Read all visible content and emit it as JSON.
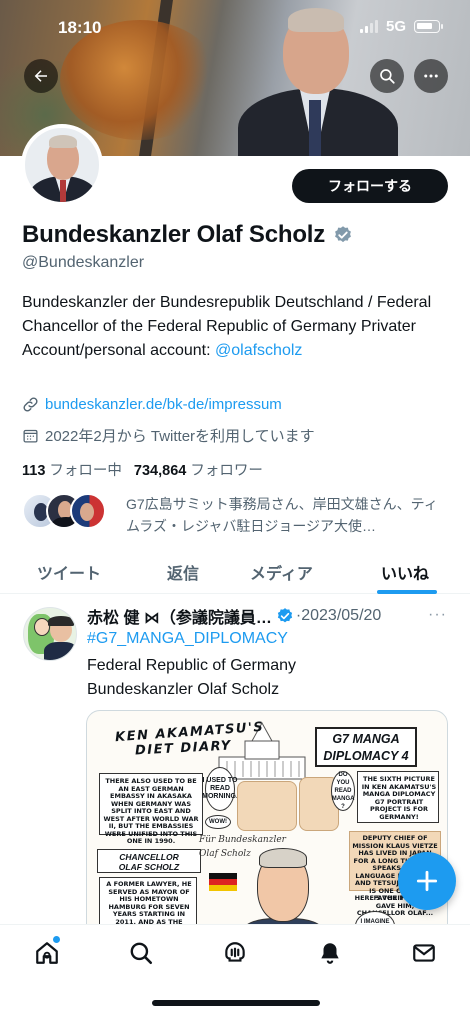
{
  "status_bar": {
    "time": "18:10",
    "network": "5G"
  },
  "header": {
    "back_icon": "arrow-left-icon",
    "search_icon": "search-icon",
    "more_icon": "more-horizontal-icon"
  },
  "profile": {
    "follow_label": "フォローする",
    "name": "Bundeskanzler Olaf Scholz",
    "handle": "@Bundeskanzler",
    "bio": "Bundeskanzler der Bundesrepublik Deutschland / Federal Chancellor of the Federal Republic of Germany Privater Account/personal account:",
    "bio_mention": "@olafscholz",
    "link": "bundeskanzler.de/bk-de/impressum",
    "joined": "2022年2月から Twitterを利用しています",
    "following_count": "113",
    "following_label": "フォロー中",
    "followers_count": "734,864",
    "followers_label": "フォロワー",
    "known_followers": "G7広島サミット事務局さん、岸田文雄さん、ティムラズ・レジャバ駐日ジョージア大使…"
  },
  "tabs": [
    {
      "label": "ツイート"
    },
    {
      "label": "返信"
    },
    {
      "label": "メディア"
    },
    {
      "label": "いいね"
    }
  ],
  "active_tab": "いいね",
  "tweet": {
    "author": "赤松 健 ⋈（参議院議員…",
    "date": "·2023/05/20",
    "more": "···",
    "hashtag": "#G7_MANGA_DIPLOMACY",
    "line1": "Federal Republic of Germany",
    "line2": "Bundeskanzler Olaf Scholz",
    "image": {
      "title_line1": "KEN AKAMATSU'S",
      "title_line2": "DIET DIARY",
      "series_line1": "G7 MANGA",
      "series_line2": "DIPLOMACY 4",
      "caption_left": "THERE ALSO USED TO BE AN EAST GERMAN EMBASSY IN AKASAKA WHEN GERMANY WAS SPLIT INTO EAST AND WEST AFTER WORLD WAR II, BUT THE EMBASSIES WERE UNIFIED INTO THIS ONE IN 1990.",
      "bubble_used": "I USED TO READ MORNING.",
      "bubble_wow": "WOW!",
      "bubble_do_you": "DO YOU READ MANGA ?",
      "caption_right": "THE SIXTH PICTURE IN KEN AKAMATSU'S MANGA DIPLOMACY G7 PORTRAIT PROJECT IS FOR GERMANY!",
      "chancellor_line1": "CHANCELLOR",
      "chancellor_line2": "OLAF SCHOLZ",
      "fur_line1": "Für Bundeskanzler",
      "fur_line2": "Olaf Scholz",
      "former_lawyer": "A FORMER LAWYER, HE SERVED AS MAYOR OF HIS HOMETOWN HAMBURG FOR SEVEN YEARS STARTING IN 2011, AND AS THE MERKEL ADMINISTRATION'S",
      "deputy": "DEPUTY CHIEF OF MISSION KLAUS VIETZE HAS LIVED IN JAPAN FOR A LONG TIME AND SPEAKS THE LANGUAGE FLUENTLY. AND TETSUJIN GAMES IS ONE OF HIS FAVORITES!",
      "here_is": "HERE'S THE PICTURE I GAVE HIM, CHANCELLOR OLAF...",
      "imagine": "I IMAGINE KODANSHA..."
    }
  },
  "colors": {
    "accent": "#1d9bf0",
    "text_primary": "#0f1419",
    "text_secondary": "#536471"
  },
  "bottom_nav": [
    {
      "icon": "home-icon"
    },
    {
      "icon": "search-icon"
    },
    {
      "icon": "spaces-icon"
    },
    {
      "icon": "notifications-bell-icon"
    },
    {
      "icon": "messages-envelope-icon"
    }
  ],
  "fab_icon": "compose-plus-icon"
}
